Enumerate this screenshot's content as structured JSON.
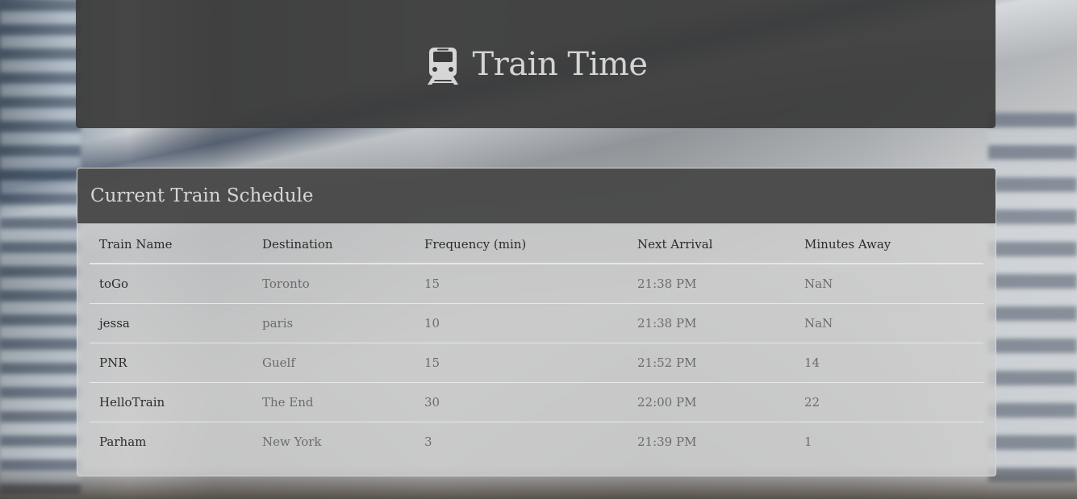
{
  "header": {
    "title": "Train Time",
    "icon": "train-icon"
  },
  "schedule": {
    "panel_title": "Current Train Schedule",
    "columns": [
      "Train Name",
      "Destination",
      "Frequency (min)",
      "Next Arrival",
      "Minutes Away"
    ],
    "rows": [
      {
        "name": "toGo",
        "destination": "Toronto",
        "frequency": "15",
        "next_arrival": "21:38 PM",
        "minutes_away": "NaN"
      },
      {
        "name": "jessa",
        "destination": "paris",
        "frequency": "10",
        "next_arrival": "21:38 PM",
        "minutes_away": "NaN"
      },
      {
        "name": "PNR",
        "destination": "Guelf",
        "frequency": "15",
        "next_arrival": "21:52 PM",
        "minutes_away": "14"
      },
      {
        "name": "HelloTrain",
        "destination": "The End",
        "frequency": "30",
        "next_arrival": "22:00 PM",
        "minutes_away": "22"
      },
      {
        "name": "Parham",
        "destination": "New York",
        "frequency": "3",
        "next_arrival": "21:39 PM",
        "minutes_away": "1"
      }
    ]
  },
  "colors": {
    "header_bg": "#3a3a3a",
    "heading_text": "#d4d4d4",
    "body_text": "#2b2b2b",
    "muted_text": "#6c6c6c"
  }
}
